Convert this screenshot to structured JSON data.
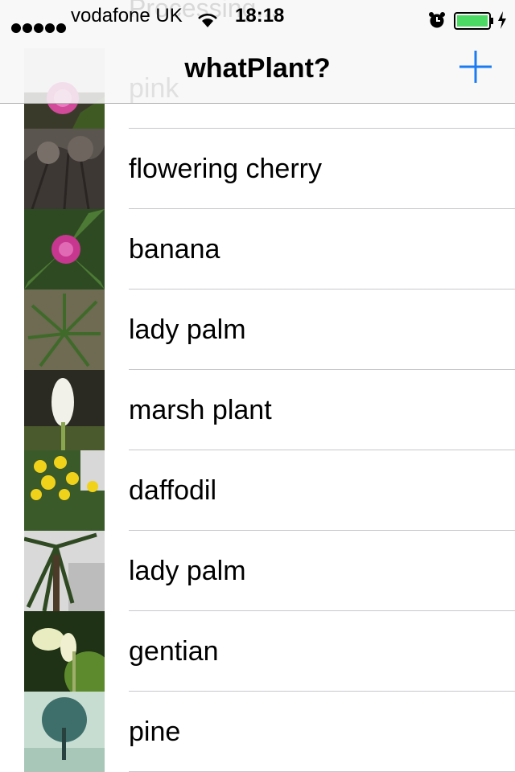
{
  "status_bar": {
    "carrier": "vodafone UK",
    "time": "18:18",
    "signal_bars": 5
  },
  "nav": {
    "title": "whatPlant?",
    "add_icon": "plus-icon",
    "accent_color": "#1a7cf2"
  },
  "under_header": {
    "processing_text": "Processing...",
    "first_item_label": "pink"
  },
  "plants": [
    {
      "label": "flowering cherry"
    },
    {
      "label": "banana"
    },
    {
      "label": "lady palm"
    },
    {
      "label": "marsh plant"
    },
    {
      "label": "daffodil"
    },
    {
      "label": "lady palm"
    },
    {
      "label": "gentian"
    },
    {
      "label": "pine"
    }
  ]
}
